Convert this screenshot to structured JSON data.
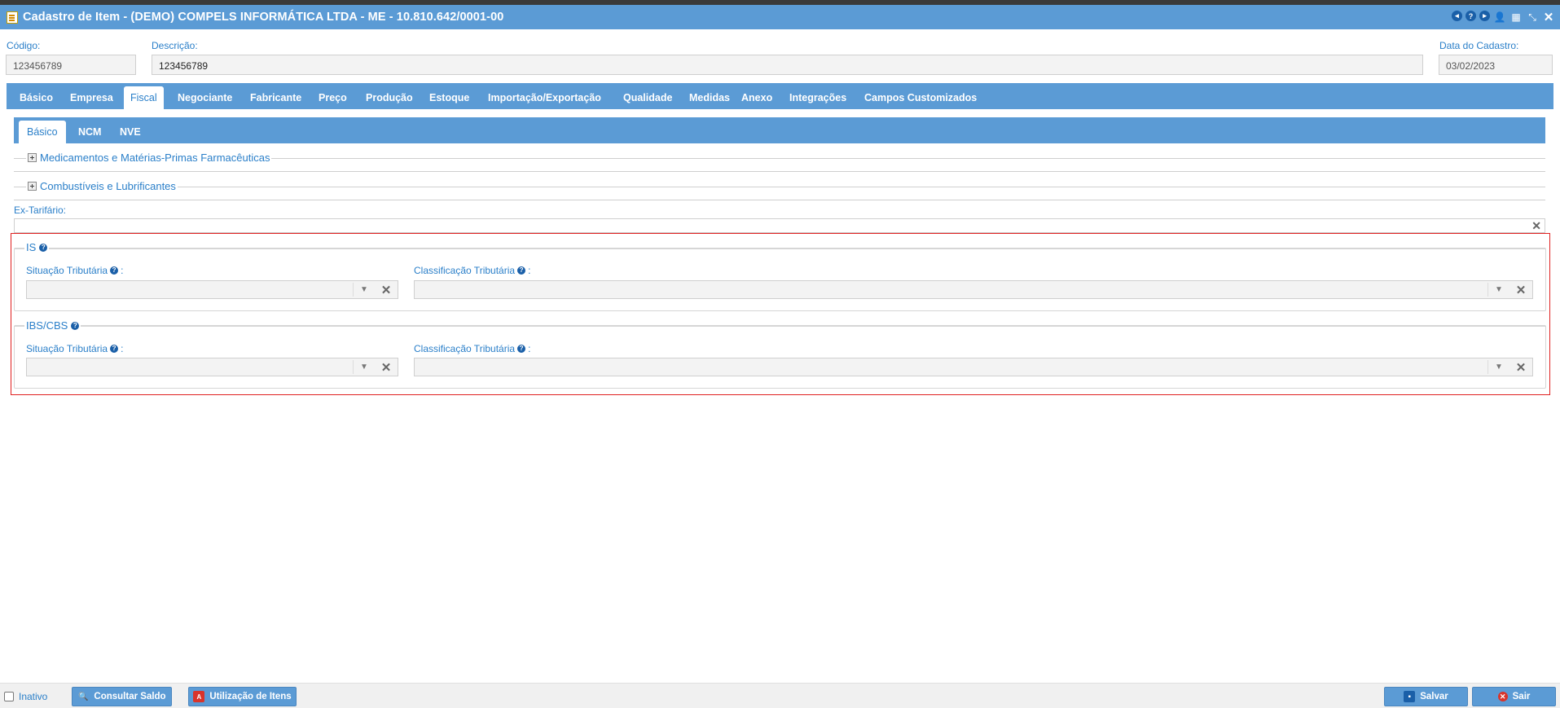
{
  "window": {
    "title": "Cadastro de Item - (DEMO) COMPELS INFORMÁTICA LTDA - ME - 10.810.642/0001-00"
  },
  "header": {
    "codigo_label": "Código:",
    "codigo_value": "123456789",
    "descricao_label": "Descrição:",
    "descricao_value": "123456789",
    "data_label": "Data do Cadastro:",
    "data_value": "03/02/2023"
  },
  "main_tabs": [
    "Básico",
    "Empresa",
    "Fiscal",
    "Negociante",
    "Fabricante",
    "Preço",
    "Produção",
    "Estoque",
    "Importação/Exportação",
    "Qualidade",
    "Medidas",
    "Anexo",
    "Integrações",
    "Campos Customizados"
  ],
  "active_main_tab": "Fiscal",
  "sub_tabs": [
    "Básico",
    "NCM",
    "NVE"
  ],
  "active_sub_tab": "Básico",
  "sections": {
    "medicamentos": "Medicamentos e Matérias-Primas Farmacêuticas",
    "combustiveis": "Combustíveis e Lubrificantes",
    "ex_tarifario_label": "Ex-Tarifário:",
    "is_title": "IS",
    "ibs_title": "IBS/CBS",
    "situacao_label": "Situação Tributária",
    "classificacao_label": "Classificação Tributária",
    "colon": ":"
  },
  "footer": {
    "inativo_label": "Inativo",
    "consultar_label": "Consultar Saldo",
    "utilizacao_label": "Utilização de Itens",
    "salvar_label": "Salvar",
    "sair_label": "Sair"
  },
  "colors": {
    "accent": "#5b9bd5",
    "label": "#2a7fc9",
    "highlight_border": "#e02020"
  }
}
